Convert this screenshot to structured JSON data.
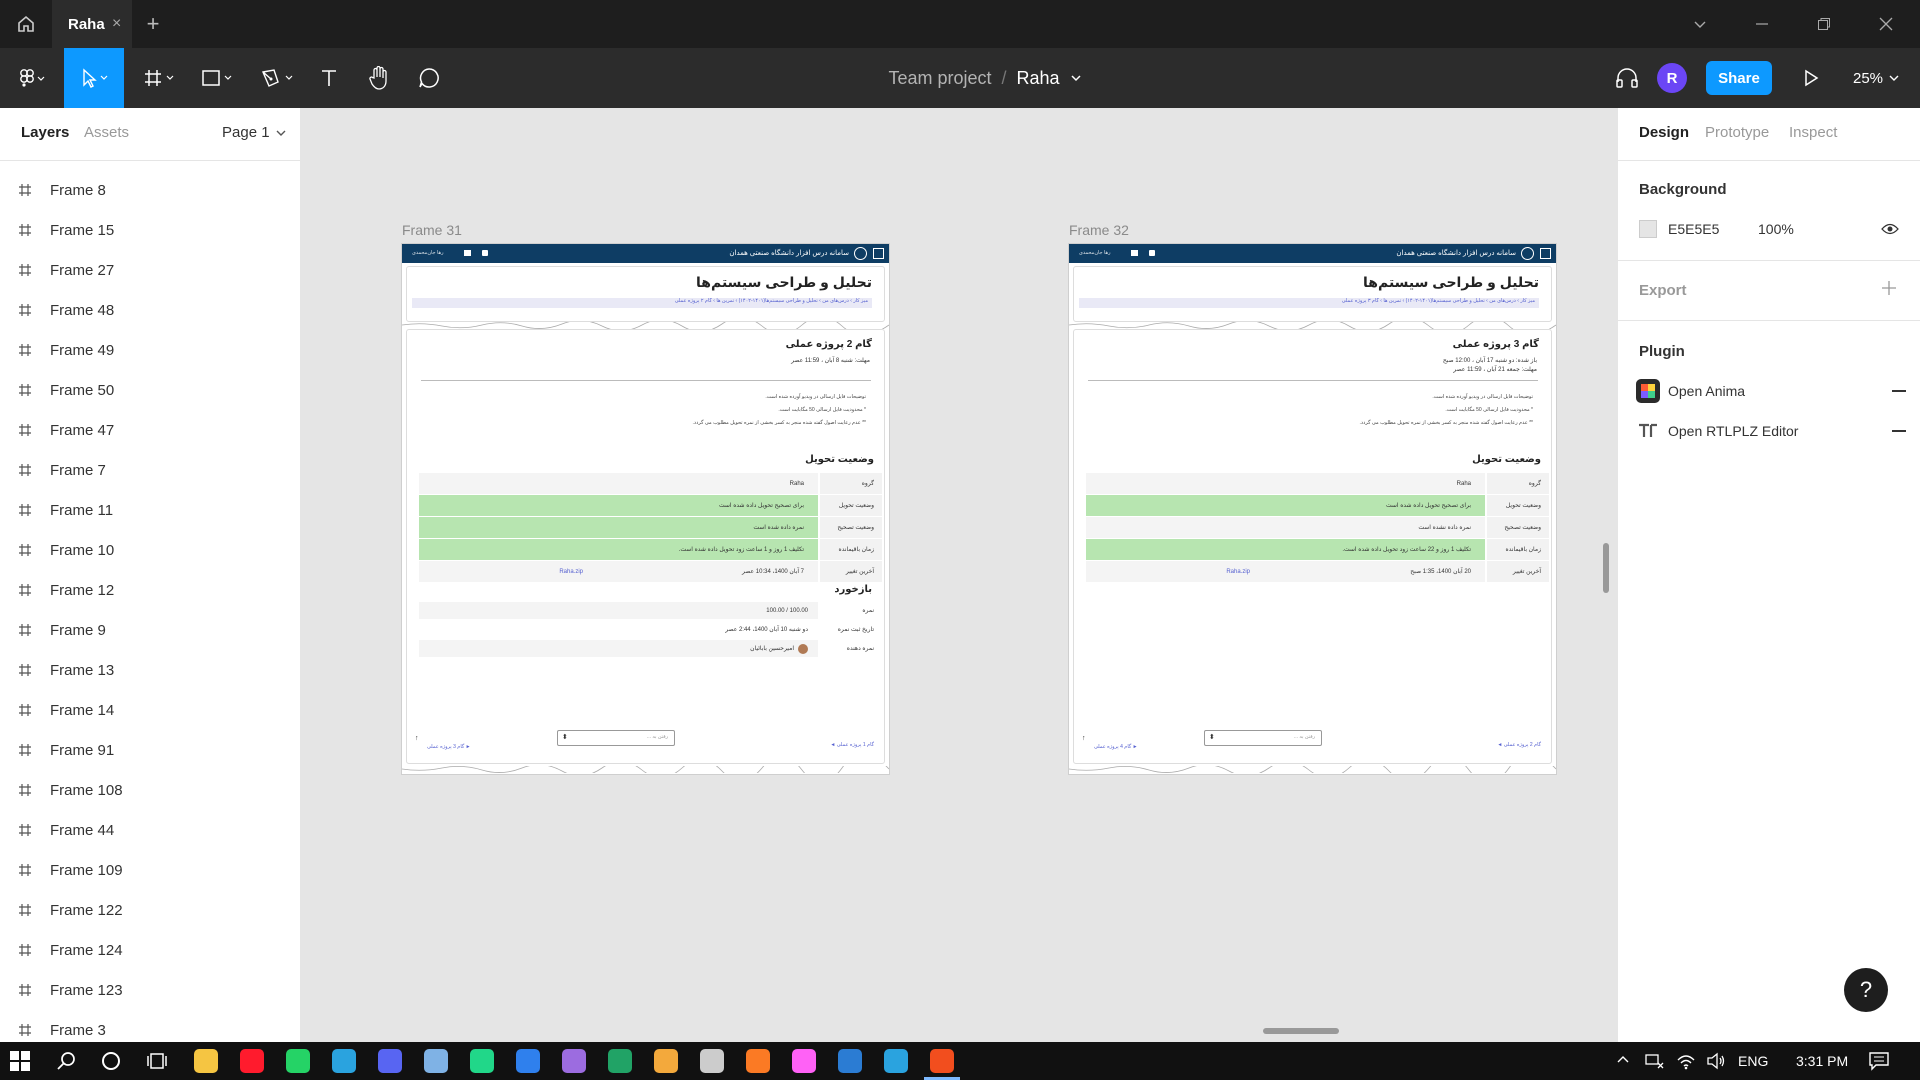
{
  "titlebar": {
    "tab_label": "Raha",
    "tab_close": "×",
    "new_tab": "+"
  },
  "toolbar": {
    "project": "Team project",
    "separator": "/",
    "file_name": "Raha",
    "avatar_letter": "R",
    "share_label": "Share",
    "zoom": "25%"
  },
  "left_panel": {
    "tabs": [
      "Layers",
      "Assets"
    ],
    "page_label": "Page 1",
    "layers": [
      "Frame 8",
      "Frame 15",
      "Frame 27",
      "Frame 48",
      "Frame 49",
      "Frame 50",
      "Frame 47",
      "Frame 7",
      "Frame 11",
      "Frame 10",
      "Frame 12",
      "Frame 9",
      "Frame 13",
      "Frame 14",
      "Frame 91",
      "Frame 108",
      "Frame 44",
      "Frame 109",
      "Frame 122",
      "Frame 124",
      "Frame 123",
      "Frame 3"
    ]
  },
  "right_panel": {
    "tabs": [
      "Design",
      "Prototype",
      "Inspect"
    ],
    "background_title": "Background",
    "bg_hex": "E5E5E5",
    "bg_opacity": "100%",
    "export_title": "Export",
    "plugin_title": "Plugin",
    "plugins": [
      "Open Anima",
      "Open RTLPLZ Editor"
    ],
    "help": "?"
  },
  "frames": [
    {
      "label": "Frame 31",
      "site_title": "سامانه درس افزار دانشگاه صنعتی همدان",
      "user": "رها جان‌محمدی",
      "course_title": "تحلیل و طراحی سیستم‌ها",
      "breadcrumb": "میز کار › درس‌های من › تحلیل و طراحی سیستم‌ها(۱۴۰۱-۱۴۰۲) › تمرین ها › گام ۲ پروژه عملی",
      "step_title": "گام 2 پروژه عملی",
      "dates": [
        "مهلت: شنبه 8 آبان ، 11:59 عصر"
      ],
      "notes": [
        "توضیحات فایل ارسالی در ویدیو آورده شده است.",
        "* محدودیت فایل ارسالی 50 مگابایت است.",
        "** عدم رعایت اصول گفته شده منجر به کسر بخشی از نمره تحویل مطلوب می گردد."
      ],
      "status_title": "وضعیت تحویل",
      "rows": [
        {
          "k": "گروه",
          "v": "Raha"
        },
        {
          "k": "وضعیت تحویل",
          "v": "برای تصحیح تحویل داده شده است"
        },
        {
          "k": "وضعیت تصحیح",
          "v": "نمره داده شده است"
        },
        {
          "k": "زمان باقیمانده",
          "v": "تکلیف 1 روز و 1 ساعت زود تحویل داده شده است."
        },
        {
          "k": "آخرین تغییر",
          "v": "7 آبان 1400، 10:34 عصر",
          "file": "Raha.zip"
        }
      ],
      "feedback_title": "بازخورد",
      "feedback": [
        {
          "k": "نمره",
          "v": "100.00 / 100.00"
        },
        {
          "k": "تاریخ ثبت نمره",
          "v": "دو شنبه 10 آبان 1400، 2:44 عصر"
        },
        {
          "k": "نمره دهنده",
          "v": "امیرحسین بابائیان"
        }
      ],
      "jump_placeholder": "رفتن به ...",
      "prev_link": "گام 1 پروژه عملی ◄",
      "next_link": "► گام 3 پروژه عملی"
    },
    {
      "label": "Frame 32",
      "site_title": "سامانه درس افزار دانشگاه صنعتی همدان",
      "user": "رها جان‌محمدی",
      "course_title": "تحلیل و طراحی سیستم‌ها",
      "breadcrumb": "میز کار › درس‌های من › تحلیل و طراحی سیستم‌ها(۱۴۰۱-۱۴۰۲) › تمرین ها › گام ۳ پروژه عملی",
      "step_title": "گام 3 پروژه عملی",
      "dates": [
        "باز شده: دو شنبه 17 آبان ، 12:00 صبح",
        "مهلت: جمعه 21 آبان ، 11:59 عصر"
      ],
      "notes": [
        "توضیحات فایل ارسالی در ویدیو آورده شده است.",
        "* محدودیت فایل ارسالی 50 مگابایت است.",
        "** عدم رعایت اصول گفته شده منجر به کسر بخشی از نمره تحویل مطلوب می گردد."
      ],
      "status_title": "وضعیت تحویل",
      "rows": [
        {
          "k": "گروه",
          "v": "Raha"
        },
        {
          "k": "وضعیت تحویل",
          "v": "برای تصحیح تحویل داده شده است"
        },
        {
          "k": "وضعیت تصحیح",
          "v": "نمره داده نشده است"
        },
        {
          "k": "زمان باقیمانده",
          "v": "تکلیف 1 روز و 22 ساعت زود تحویل داده شده است."
        },
        {
          "k": "آخرین تغییر",
          "v": "20 آبان 1400، 1:35 صبح",
          "file": "Raha.zip"
        }
      ],
      "feedback_title": "",
      "feedback": [],
      "jump_placeholder": "رفتن به ...",
      "prev_link": "گام 2 پروژه عملی ◄",
      "next_link": "► گام 4 پروژه عملی"
    }
  ],
  "taskbar": {
    "lang": "ENG",
    "time": "3:31 PM"
  },
  "colors": {
    "accent": "#0d99ff",
    "frame_header": "#0e3d64",
    "green_row": "#b7e5b0",
    "ink": "#333333"
  }
}
